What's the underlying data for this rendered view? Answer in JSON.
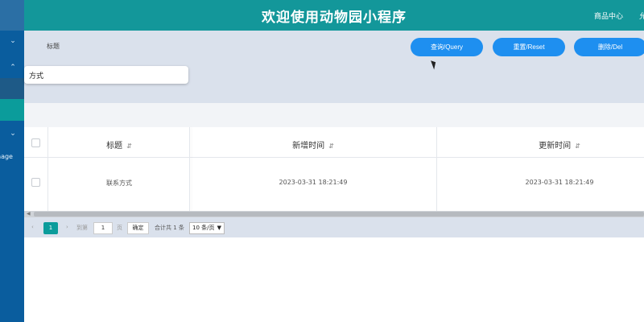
{
  "header": {
    "title": "欢迎使用动物园小程序",
    "menu_goods": "商品中心",
    "menu_cut": "允"
  },
  "sidebar": {
    "cut_label": "nage"
  },
  "search": {
    "label": "标题",
    "dropdown_value": "方式",
    "query_label": "查询/Query",
    "reset_label": "重置/Reset",
    "delete_label": "删除/Del"
  },
  "table": {
    "columns": [
      "标题",
      "新增时间",
      "更新时间"
    ],
    "rows": [
      [
        "联系方式",
        "2023-03-31 18:21:49",
        "2023-03-31 18:21:49"
      ]
    ]
  },
  "pager": {
    "current_page": "1",
    "goto_label": "到第",
    "page_input": "1",
    "page_unit": "页",
    "confirm_label": "确定",
    "total_label": "合计共 1 条",
    "page_size": "10 条/页"
  },
  "colors": {
    "header": "#13979a",
    "sidebar": "#0a5d9e",
    "button": "#1e8ff0",
    "active_page": "#0b9c9b"
  }
}
